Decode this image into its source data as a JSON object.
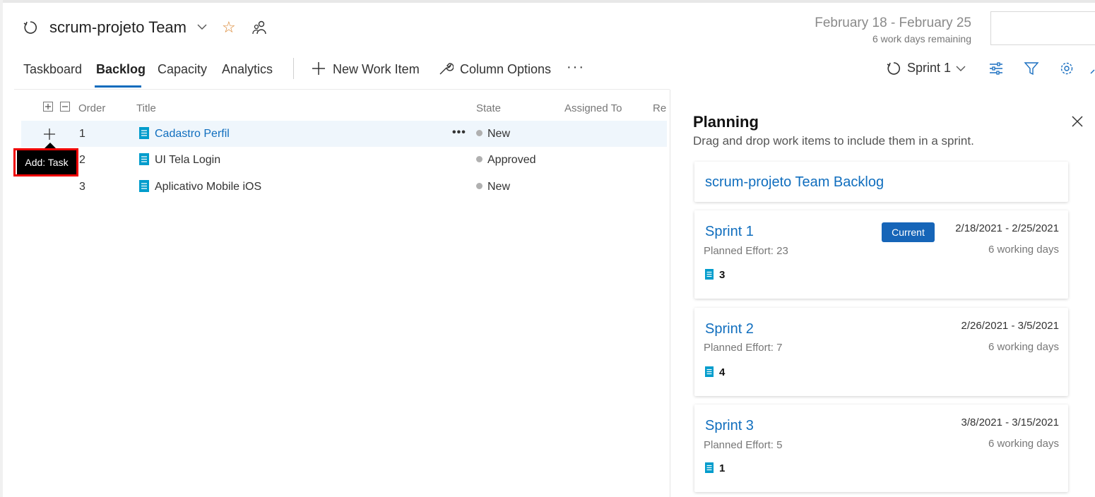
{
  "header": {
    "team_name": "scrum-projeto Team",
    "date_range": "February 18 - February 25",
    "remaining": "6 work days remaining"
  },
  "nav": {
    "tabs": [
      "Taskboard",
      "Backlog",
      "Capacity",
      "Analytics"
    ],
    "selected_tab": "Backlog",
    "new_work_item": "New Work Item",
    "column_options": "Column Options",
    "more": "···",
    "sprint_selector": "Sprint 1"
  },
  "grid": {
    "columns": [
      "Order",
      "Title",
      "State",
      "Assigned To",
      "Rer"
    ],
    "rows": [
      {
        "order": "1",
        "title": "Cadastro Perfil",
        "state": "New"
      },
      {
        "order": "2",
        "title": "UI Tela Login",
        "state": "Approved"
      },
      {
        "order": "3",
        "title": "Aplicativo Mobile iOS",
        "state": "New"
      }
    ],
    "row_more": "•••",
    "tooltip": "Add: Task"
  },
  "planning": {
    "title": "Planning",
    "subtitle": "Drag and drop work items to include them in a sprint.",
    "backlog_card": "scrum-projeto Team Backlog",
    "sprints": [
      {
        "name": "Sprint 1",
        "badge": "Current",
        "dates": "2/18/2021 - 2/25/2021",
        "days": "6 working days",
        "effort": "Planned Effort: 23",
        "count": "3"
      },
      {
        "name": "Sprint 2",
        "dates": "2/26/2021 - 3/5/2021",
        "days": "6 working days",
        "effort": "Planned Effort: 7",
        "count": "4"
      },
      {
        "name": "Sprint 3",
        "dates": "3/8/2021 - 3/15/2021",
        "days": "6 working days",
        "effort": "Planned Effort: 5",
        "count": "1"
      }
    ]
  },
  "colors": {
    "accent": "#0f6cbd",
    "link": "#106ebe",
    "work_item_icon": "#009ccc",
    "star": "#d9822b",
    "badge": "#1665b8",
    "state_dot": "#b0b0b0",
    "highlight": "#e00000"
  }
}
